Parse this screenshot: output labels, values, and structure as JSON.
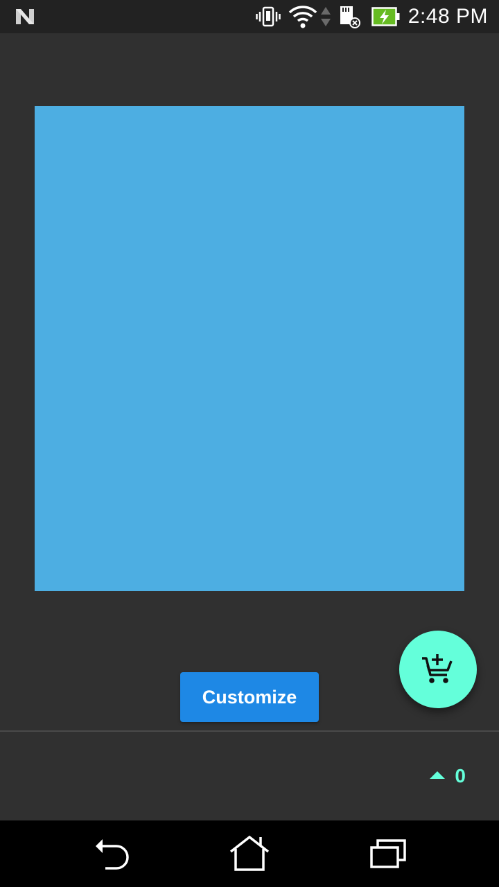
{
  "status_bar": {
    "time": "2:48 PM",
    "icons": [
      "notification-n-icon",
      "vibrate-icon",
      "wifi-icon",
      "data-arrows-icon",
      "sd-card-error-icon",
      "battery-charging-icon"
    ]
  },
  "main": {
    "hero_color": "#4daee2",
    "customize_label": "Customize",
    "customize_color": "#1e88e5",
    "fab_icon": "add-to-cart-icon",
    "fab_color": "#64ffda"
  },
  "bottom": {
    "counter_value": "0",
    "counter_color": "#64ffda"
  },
  "nav_bar": {
    "buttons": [
      "back-icon",
      "home-icon",
      "recents-icon"
    ]
  }
}
